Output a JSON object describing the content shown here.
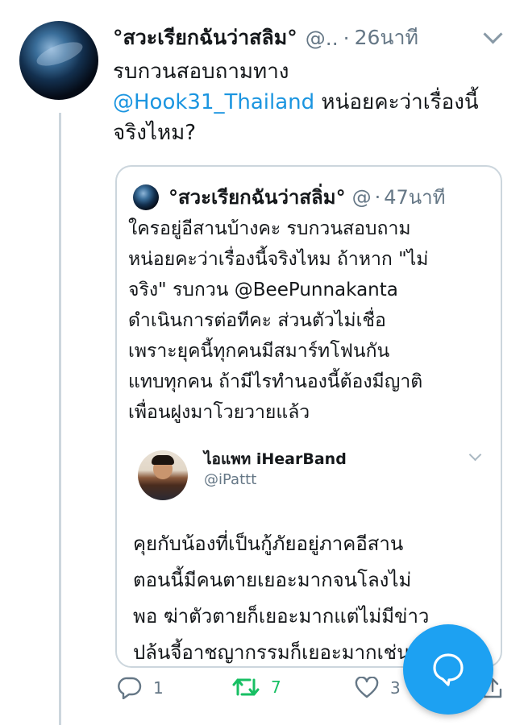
{
  "tweet": {
    "display_name": "°สวะเรียกฉันว่าสลิม°",
    "handle": "@..",
    "dot": "·",
    "time": "26นาที",
    "text_line1": "รบกวนสอบถามทาง",
    "mention": "@Hook31_Thailand",
    "text_after_mention": " หน่อยคะว่าเรื่องนี้",
    "text_line3": "จริงไหม?"
  },
  "quote": {
    "display_name": "°สวะเรียกฉันว่าสลิ่ม°",
    "handle": "@",
    "dot": "·",
    "time": "47นาที",
    "text": "ใครอยู่อีสานบ้างคะ รบกวนสอบถาม\nหน่อยคะว่าเรื่องนี้จริงไหม ถ้าหาก \"ไม่\nจริง\" รบกวน @BeePunnakanta\n ดำเนินการต่อทีคะ ส่วนตัวไม่เชื่อ\nเพราะยุคนี้ทุกคนมีสมาร์ทโฟนกัน\nแทบทุกคน ถ้ามีไรทำนองนี้ต้องมีญาติ\nเพื่อนฝูงมาโวยวายแล้ว"
  },
  "embedded": {
    "display_name": "ไอแพท iHearBand",
    "handle": "@iPattt",
    "text": "คุยกับน้องที่เป็นกู้ภัยอยู่ภาคอีสาน\nตอนนี้มีคนตายเยอะมากจนโลงไม่\nพอ ฆ่าตัวตายก็เยอะมากแต่ไม่มีข่าว\nปล้นจี้อาชญากรรมก็เยอะมากเช่นกัน"
  },
  "actions": {
    "reply_count": "1",
    "retweet_count": "7",
    "like_count": "3"
  },
  "icons": {
    "reply": "reply-icon",
    "retweet": "retweet-icon",
    "like": "heart-icon",
    "share": "share-icon",
    "compose": "compose-chat-icon"
  },
  "colors": {
    "link": "#1b95e0",
    "retweet": "#17bf63",
    "fab": "#1da1f2"
  }
}
